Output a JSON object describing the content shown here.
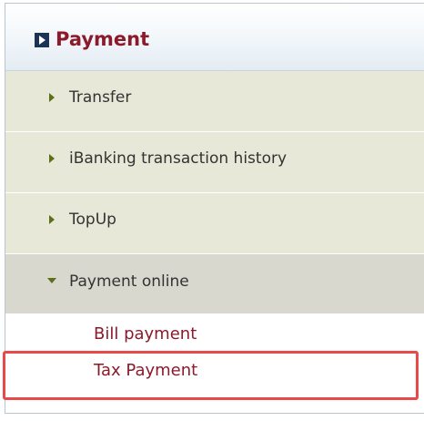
{
  "menu": {
    "header": {
      "title": "Payment",
      "icon": "box-arrow-icon"
    },
    "items": [
      {
        "label": "Transfer",
        "icon": "triangle-right-icon",
        "expanded": false
      },
      {
        "label": "iBanking transaction history",
        "icon": "triangle-right-icon",
        "expanded": false
      },
      {
        "label": "TopUp",
        "icon": "triangle-right-icon",
        "expanded": false
      },
      {
        "label": "Payment online",
        "icon": "triangle-down-icon",
        "expanded": true
      }
    ],
    "subitems": [
      {
        "label": "Bill payment",
        "highlighted": false
      },
      {
        "label": "Tax Payment",
        "highlighted": true
      }
    ]
  },
  "colors": {
    "title": "#8b1a2a",
    "menu_bg": "#e8e8d8",
    "menu_bg_active": "#d8d8ce",
    "arrow": "#5c6f1a",
    "highlight": "#e84a4a"
  }
}
